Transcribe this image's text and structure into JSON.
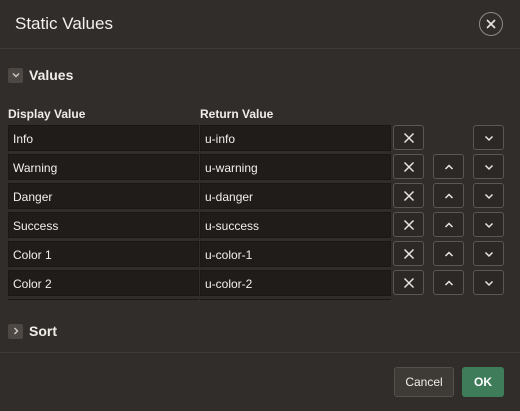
{
  "dialog": {
    "title": "Static Values",
    "close_icon": "close-icon"
  },
  "values_section": {
    "title": "Values",
    "expanded": true,
    "columns": {
      "display": "Display Value",
      "return": "Return Value"
    },
    "rows": [
      {
        "display": "Info",
        "return": "u-info",
        "move_up": false,
        "move_down": true
      },
      {
        "display": "Warning",
        "return": "u-warning",
        "move_up": true,
        "move_down": true
      },
      {
        "display": "Danger",
        "return": "u-danger",
        "move_up": true,
        "move_down": true
      },
      {
        "display": "Success",
        "return": "u-success",
        "move_up": true,
        "move_down": true
      },
      {
        "display": "Color 1",
        "return": "u-color-1",
        "move_up": true,
        "move_down": true
      },
      {
        "display": "Color 2",
        "return": "u-color-2",
        "move_up": true,
        "move_down": true
      }
    ]
  },
  "sort_section": {
    "title": "Sort",
    "expanded": false
  },
  "footer": {
    "cancel_label": "Cancel",
    "ok_label": "OK"
  },
  "colors": {
    "background": "#312d2a",
    "input_bg": "#1f1c1a",
    "ok_green": "#3f7d5a"
  }
}
